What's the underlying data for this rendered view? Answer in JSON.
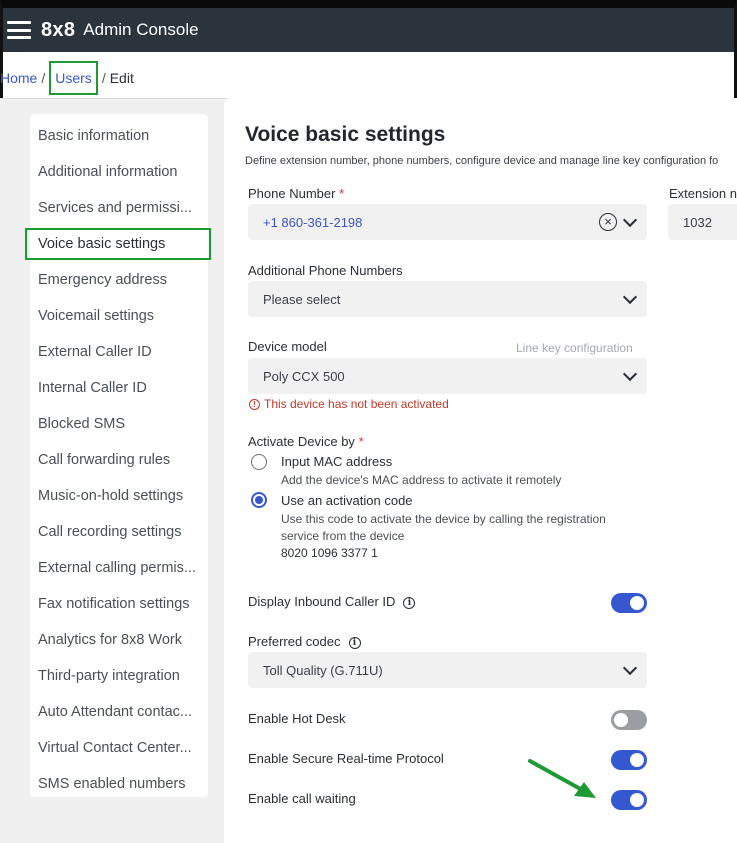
{
  "header": {
    "logo": "8x8",
    "title": "Admin Console"
  },
  "breadcrumb": {
    "home": "Home",
    "users": "Users",
    "current": "Edit",
    "sep": "/"
  },
  "sidebar": {
    "items": [
      {
        "label": "Basic information"
      },
      {
        "label": "Additional information"
      },
      {
        "label": "Services and permissi..."
      },
      {
        "label": "Voice basic settings"
      },
      {
        "label": "Emergency address"
      },
      {
        "label": "Voicemail settings"
      },
      {
        "label": "External Caller ID"
      },
      {
        "label": "Internal Caller ID"
      },
      {
        "label": "Blocked SMS"
      },
      {
        "label": "Call forwarding rules"
      },
      {
        "label": "Music-on-hold settings"
      },
      {
        "label": "Call recording settings"
      },
      {
        "label": "External calling permis..."
      },
      {
        "label": "Fax notification settings"
      },
      {
        "label": "Analytics for 8x8 Work"
      },
      {
        "label": "Third-party integration"
      },
      {
        "label": "Auto Attendant contac..."
      },
      {
        "label": "Virtual Contact Center..."
      },
      {
        "label": "SMS enabled numbers"
      }
    ],
    "active_index": 3
  },
  "main": {
    "title": "Voice basic settings",
    "subtitle": "Define extension number, phone numbers, configure device and manage line key configuration fo",
    "phone_number": {
      "label": "Phone Number",
      "required": "*",
      "value": "+1 860-361-2198",
      "clear": "×"
    },
    "extension": {
      "label": "Extension n",
      "value": "1032"
    },
    "additional_phones": {
      "label": "Additional Phone Numbers",
      "placeholder": "Please select"
    },
    "device_model": {
      "label": "Device model",
      "link": "Line key configuration",
      "value": "Poly CCX 500",
      "error": "This device has not been activated",
      "error_icon": "!"
    },
    "activate": {
      "label": "Activate Device by",
      "required": "*",
      "option_mac": {
        "label": "Input MAC address",
        "help": "Add the device's MAC address to activate it remotely"
      },
      "option_code": {
        "label": "Use an activation code",
        "help": "Use this code to activate the device by calling the registration service from the device",
        "code": "8020 1096 3377 1"
      }
    },
    "display_inbound": {
      "label": "Display Inbound Caller ID",
      "on": true
    },
    "codec": {
      "label": "Preferred codec",
      "value": "Toll Quality (G.711U)"
    },
    "hot_desk": {
      "label": "Enable Hot Desk",
      "on": false
    },
    "srtp": {
      "label": "Enable Secure Real-time Protocol",
      "on": true
    },
    "call_waiting": {
      "label": "Enable call waiting",
      "on": true
    },
    "info_glyph": "i"
  },
  "colors": {
    "accent": "#3558d0",
    "highlight": "#1e9a35",
    "topbar": "#2b333d",
    "error": "#c0392b"
  }
}
